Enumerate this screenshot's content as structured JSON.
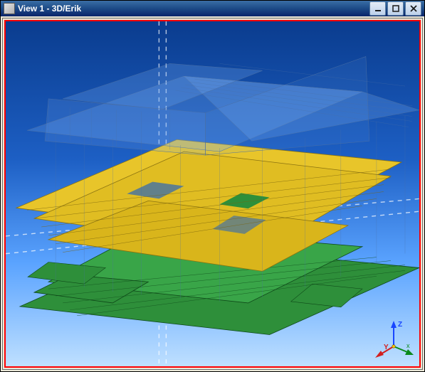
{
  "window": {
    "title": "View 1 - 3D/Erik"
  },
  "axis": {
    "z": "Z",
    "y": "Y",
    "x": "x"
  }
}
